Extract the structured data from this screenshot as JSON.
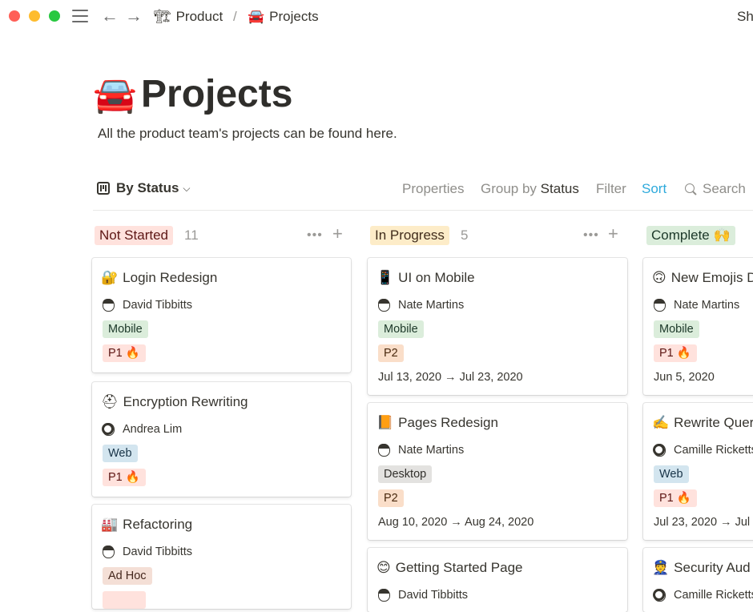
{
  "breadcrumb": {
    "parent_icon": "🏗",
    "parent": "Product",
    "separator": "/",
    "current_icon": "🚘",
    "current": "Projects"
  },
  "share_label": "Sh",
  "page": {
    "icon": "🚘",
    "title": "Projects",
    "description": "All the product team's projects can be found here."
  },
  "toolbar": {
    "view_label": "By Status",
    "properties": "Properties",
    "group_by": "Group by",
    "group_value": "Status",
    "filter": "Filter",
    "sort": "Sort",
    "search": "Search"
  },
  "columns": [
    {
      "label": "Not Started",
      "count": "11",
      "color": "#ffe2dd",
      "text_color": "#5d1715",
      "menu": "•••",
      "add": "+",
      "cards": [
        {
          "icon": "🔐",
          "title": "Login Redesign",
          "person": "David Tibbitts",
          "tags": [
            "Mobile",
            "P1 🔥"
          ]
        },
        {
          "icon": "⛑",
          "title": "Encryption Rewriting",
          "person": "Andrea Lim",
          "tags": [
            "Web",
            "P1 🔥"
          ]
        },
        {
          "icon": "🏭",
          "title": "Refactoring",
          "person": "David Tibbitts",
          "tags": [
            "Ad Hoc"
          ]
        }
      ]
    },
    {
      "label": "In Progress",
      "count": "5",
      "color": "#fdecc8",
      "text_color": "#402c1b",
      "menu": "•••",
      "add": "+",
      "cards": [
        {
          "icon": "📱",
          "title": "UI on Mobile",
          "person": "Nate Martins",
          "tags": [
            "Mobile",
            "P2"
          ],
          "date": "Jul 13, 2020 → Jul 23, 2020"
        },
        {
          "icon": "📙",
          "title": "Pages Redesign",
          "person": "Nate Martins",
          "tags": [
            "Desktop",
            "P2"
          ],
          "date": "Aug 10, 2020 → Aug 24, 2020"
        },
        {
          "icon": "😊",
          "title": "Getting Started Page",
          "person": "David Tibbitts",
          "tags": []
        }
      ]
    },
    {
      "label": "Complete 🙌",
      "count": "",
      "color": "#dbeddb",
      "text_color": "#1c3829",
      "cards": [
        {
          "icon": "🙃",
          "title": "New Emojis D",
          "person": "Nate Martins",
          "tags": [
            "Mobile",
            "P1 🔥"
          ],
          "date": "Jun 5, 2020"
        },
        {
          "icon": "✍️",
          "title": "Rewrite Quer",
          "person": "Camille Ricketts",
          "tags": [
            "Web",
            "P1 🔥"
          ],
          "date": "Jul 23, 2020 → Jul"
        },
        {
          "icon": "👮",
          "title": "Security Aud",
          "person": "Camille Ricketts",
          "tags": []
        }
      ]
    }
  ],
  "tag_colors": {
    "Mobile": {
      "bg": "#dbeddb",
      "fg": "#1c3829"
    },
    "Web": {
      "bg": "#d3e5ef",
      "fg": "#183347"
    },
    "Desktop": {
      "bg": "#e3e2e0",
      "fg": "#32302c"
    },
    "Ad Hoc": {
      "bg": "#f4dfd6",
      "fg": "#44261c"
    },
    "P1 🔥": {
      "bg": "#ffe2dd",
      "fg": "#5d1715"
    },
    "P2": {
      "bg": "#fadec9",
      "fg": "#49290e"
    }
  }
}
